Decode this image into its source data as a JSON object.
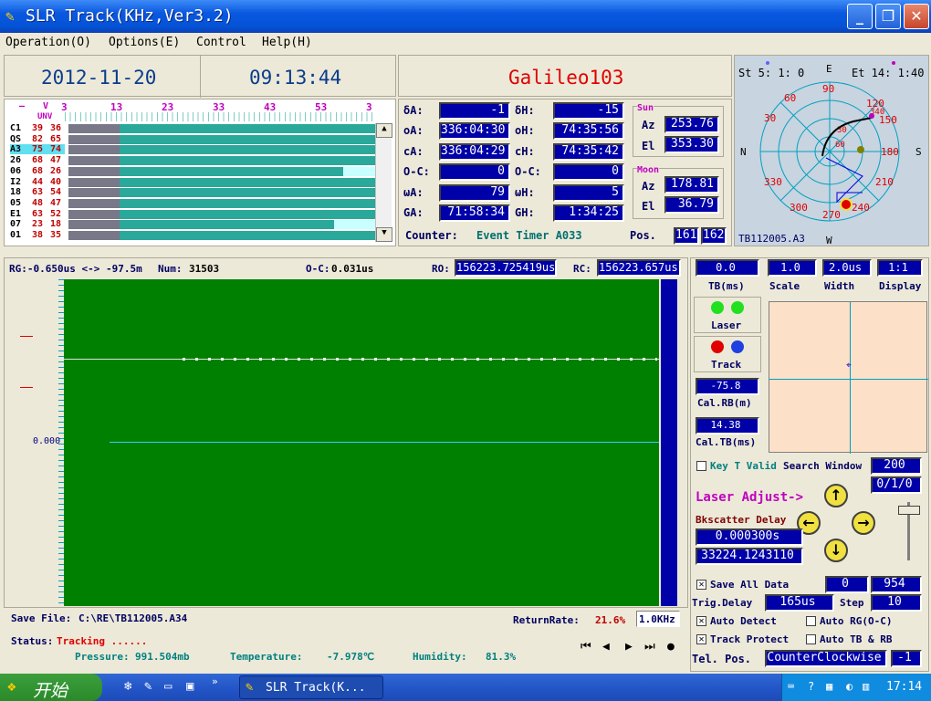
{
  "window": {
    "title": "SLR Track(KHz,Ver3.2)"
  },
  "menu": [
    "Operation(O)",
    "Options(E)",
    "Control",
    "Help(H)"
  ],
  "header": {
    "date": "2012-11-20",
    "time": "09:13:44",
    "satellite": "Galileo103"
  },
  "pass_list": {
    "v_label": "V",
    "unv_label": "UNV",
    "ticks": [
      "3",
      "13",
      "23",
      "33",
      "43",
      "53",
      "3"
    ],
    "rows": [
      {
        "name": "C1",
        "a": "39",
        "b": "36",
        "fill": 1.0,
        "cyan": 0
      },
      {
        "name": "QS",
        "a": "82",
        "b": "65",
        "fill": 1.0,
        "cyan": 0
      },
      {
        "name": "A3",
        "a": "75",
        "b": "74",
        "fill": 1.0,
        "cyan": 0,
        "selected": true
      },
      {
        "name": "26",
        "a": "68",
        "b": "47",
        "fill": 1.0,
        "cyan": 0
      },
      {
        "name": "06",
        "a": "68",
        "b": "26",
        "fill": 0.88,
        "cyan": 0.12
      },
      {
        "name": "I2",
        "a": "44",
        "b": "40",
        "fill": 1.0,
        "cyan": 0
      },
      {
        "name": "18",
        "a": "63",
        "b": "54",
        "fill": 1.0,
        "cyan": 0
      },
      {
        "name": "05",
        "a": "48",
        "b": "47",
        "fill": 1.0,
        "cyan": 0
      },
      {
        "name": "E1",
        "a": "63",
        "b": "52",
        "fill": 1.0,
        "cyan": 0
      },
      {
        "name": "07",
        "a": "23",
        "b": "18",
        "fill": 0.85,
        "cyan": 0.15
      },
      {
        "name": "01",
        "a": "38",
        "b": "35",
        "fill": 1.0,
        "cyan": 0
      }
    ]
  },
  "pointing": {
    "dA_label": "δA:",
    "dA": "-1",
    "dH_label": "δH:",
    "dH": "-15",
    "oA_label": "oA:",
    "oA": "336:04:30",
    "oH_label": "oH:",
    "oH": "74:35:56",
    "cA_label": "cA:",
    "cA": "336:04:29",
    "cH_label": "cH:",
    "cH": "74:35:42",
    "oc1_label": "O-C:",
    "oc1": "0",
    "oc2_label": "O-C:",
    "oc2": "0",
    "wA_label": "ωA:",
    "wA": "79",
    "wH_label": "ωH:",
    "wH": "5",
    "GA_label": "GA:",
    "GA": "71:58:34",
    "GH_label": "GH:",
    "GH": "1:34:25"
  },
  "sun": {
    "title": "Sun",
    "az_label": "Az",
    "az": "253.76",
    "el_label": "El",
    "el": "353.30"
  },
  "moon": {
    "title": "Moon",
    "az_label": "Az",
    "az": "178.81",
    "el_label": "El",
    "el": "36.79"
  },
  "counter": {
    "label": "Counter:",
    "value": "Event Timer A033",
    "pos_label": "Pos.",
    "pos1": "161",
    "pos2": "162"
  },
  "polar": {
    "st": "St  5: 1: 0",
    "et": "Et 14: 1:40",
    "n": "N",
    "s": "S",
    "e": "E",
    "w": "W",
    "ring": [
      "90",
      "120",
      "150",
      "180",
      "210",
      "240",
      "270",
      "300",
      "330",
      "30",
      "60"
    ],
    "inner": [
      "30",
      "60",
      "340"
    ],
    "file": "TB112005.A3"
  },
  "range": {
    "rg": "RG:-0.650us <-> -97.5m",
    "num_label": "Num:",
    "num": "31503",
    "oc_label": "O-C:",
    "oc": "0.031us",
    "ro_label": "RO:",
    "ro": "156223.725419us",
    "rc_label": "RC:",
    "rc": "156223.657us",
    "zero": "0.000"
  },
  "footer": {
    "save_label": "Save File:",
    "save": "C:\\RE\\TB112005.A34",
    "rr_label": "ReturnRate:",
    "rr": "21.6%",
    "rr2": "1.0KHz",
    "status_label": "Status:",
    "status": "Tracking ......",
    "pressure_label": "Pressure:",
    "pressure": "991.504mb",
    "temp_label": "Temperature:",
    "temp": "-7.978℃",
    "hum_label": "Humidity:",
    "hum": "81.3%"
  },
  "right": {
    "tb": "0.0",
    "tb_label": "TB(ms)",
    "scale": "1.0",
    "scale_label": "Scale",
    "width": "2.0us",
    "width_label": "Width",
    "display": "1:1",
    "display_label": "Display",
    "laser": "Laser",
    "track": "Track",
    "calrb": "-75.8",
    "calrb_label": "Cal.RB(m)",
    "caltb": "14.38",
    "caltb_label": "Cal.TB(ms)",
    "keyt": "Key T Valid",
    "sw_label": "Search Window",
    "sw": "200",
    "sw2": "0/1/0",
    "laser_adjust": "Laser Adjust->",
    "bks_label": "Bkscatter Delay",
    "bks": "0.000300s",
    "bks2": "33224.1243110",
    "saveall": "Save All Data",
    "saveall_v1": "0",
    "saveall_v2": "954",
    "trig_label": "Trig.Delay",
    "trig": "165us",
    "step_label": "Step",
    "step": "10",
    "autodetect": "Auto Detect",
    "autorg": "Auto RG(O-C)",
    "trackprotect": "Track Protect",
    "autotb": "Auto TB & RB",
    "telpos_label": "Tel. Pos.",
    "telpos": "CounterClockwise",
    "telpos2": "-1"
  },
  "taskbar": {
    "start": "开始",
    "task": "SLR Track(K...",
    "clock": "17:14"
  },
  "colors": {
    "plot_bg": "#008000",
    "value_bg": "#0000a8",
    "sat_red": "#e00000"
  }
}
